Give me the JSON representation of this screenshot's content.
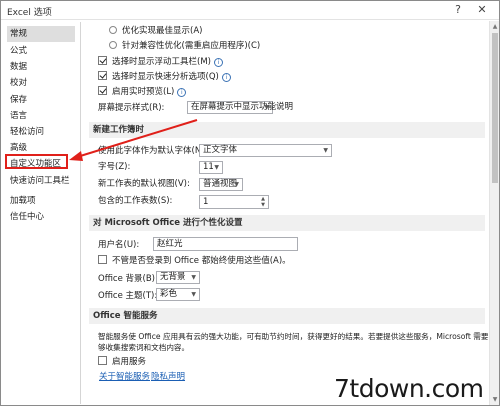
{
  "window": {
    "title": "Excel 选项",
    "help_glyph": "?",
    "close_glyph": "✕"
  },
  "sidebar": {
    "items": [
      {
        "label": "常规"
      },
      {
        "label": "公式"
      },
      {
        "label": "数据"
      },
      {
        "label": "校对"
      },
      {
        "label": "保存"
      },
      {
        "label": "语言"
      },
      {
        "label": "轻松访问"
      },
      {
        "label": "高级"
      },
      {
        "label": "自定义功能区"
      },
      {
        "label": "快速访问工具栏"
      },
      {
        "label": "加载项"
      },
      {
        "label": "信任中心"
      }
    ],
    "selected_index": 0,
    "highlight_color": "#e0201a"
  },
  "ui_options": {
    "radio_optimize": "优化实现最佳显示(A)",
    "radio_compat": "针对兼容性优化(需重启应用程序)(C)",
    "check_minitoolbar": "选择时显示浮动工具栏(M)",
    "check_quickanalysis": "选择时显示快速分析选项(Q)",
    "check_livepreview": "启用实时预览(L)",
    "tooltip_label": "屏幕提示样式(R):",
    "tooltip_value": "在屏幕提示中显示功能说明"
  },
  "new_workbook": {
    "header": "新建工作簿时",
    "font_label": "使用此字体作为默认字体(N):",
    "font_value": "正文字体",
    "size_label": "字号(Z):",
    "size_value": "11",
    "view_label": "新工作表的默认视图(V):",
    "view_value": "普通视图",
    "sheets_label": "包含的工作表数(S):",
    "sheets_value": "1"
  },
  "personalize": {
    "header": "对 Microsoft Office 进行个性化设置",
    "username_label": "用户名(U):",
    "username_value": "赵红光",
    "always_use_label": "不管是否登录到 Office 都始终使用这些值(A)。",
    "background_label": "Office 背景(B):",
    "background_value": "无背景",
    "theme_label": "Office 主题(T):",
    "theme_value": "彩色"
  },
  "intelligent": {
    "header": "Office 智能服务",
    "desc_line1": "智能服务使 Office 应用具有云的强大功能，可有助节约时间，获得更好的结果。若要提供这些服务，Microsoft 需要能",
    "desc_line2": "够收集搜索词和文档内容。",
    "enable_label": "启用服务",
    "about_link": "关于智能服务",
    "privacy_link": "隐私声明"
  },
  "watermark": "7tdown.com",
  "icons": {
    "dropdown": "chevron-down-icon",
    "info": "info-icon",
    "spinner": "spinner-icon"
  },
  "colors": {
    "arrow": "#e0201a",
    "link": "#1b5fb4",
    "section_bg": "#f0f0f0"
  }
}
